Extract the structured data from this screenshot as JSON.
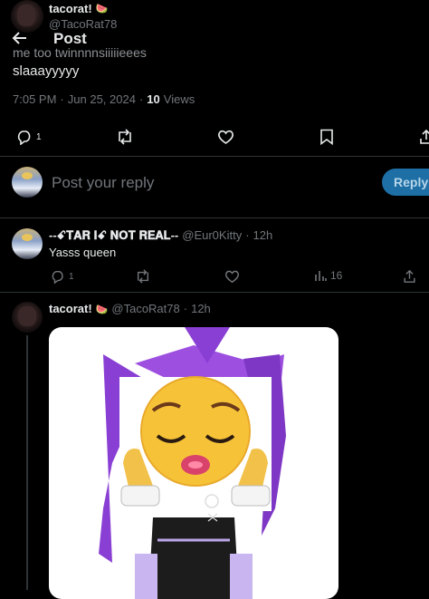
{
  "original_tweet": {
    "display_name": "tacorat!",
    "handle": "@TacoRat78",
    "text_line1": "me too twinnnnsiiiiieees",
    "text_line2": "slaaayyyyy",
    "time": "7:05 PM",
    "sep": "·",
    "date": "Jun 25, 2024",
    "views_count": "10",
    "views_label": "Views",
    "reply_count": "1"
  },
  "header": {
    "title": "Post"
  },
  "composer": {
    "placeholder": "Post your reply",
    "reply_button": "Reply"
  },
  "replies": [
    {
      "display_name": "--ꗃ𝐓𝐀𝐑 𝐈ꗃ 𝐍𝐎𝐓 𝐑𝐄𝐀𝐋--",
      "handle": "@Eur0Kitty",
      "time": "12h",
      "text": "Yasss queen",
      "reply_count": "1",
      "views_count": "16"
    },
    {
      "display_name": "tacorat!",
      "handle": "@TacoRat78",
      "time": "12h"
    }
  ],
  "colors": {
    "accent": "#1d9bf0",
    "muted": "#71767b",
    "border": "#2f3336"
  }
}
